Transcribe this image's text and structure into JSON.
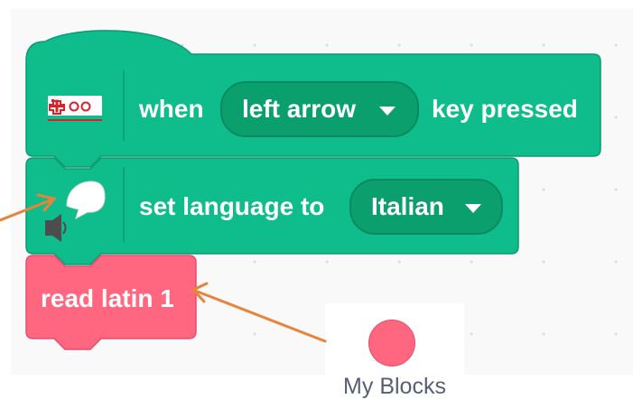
{
  "hat_block": {
    "extension_icon": "makey-makey-icon",
    "when_label": "when",
    "key_value": "left arrow",
    "pressed_label": "key pressed",
    "color": "#0fbd8c"
  },
  "command_block": {
    "extension_icon": "text-to-speech-icon",
    "label": "set language to",
    "language_value": "Italian",
    "color": "#0fbd8c"
  },
  "custom_block": {
    "label": "read latin 1",
    "color": "#ff6680"
  },
  "category": {
    "label": "My Blocks",
    "color": "#ff6680"
  },
  "annotation_color": "#e8843a"
}
